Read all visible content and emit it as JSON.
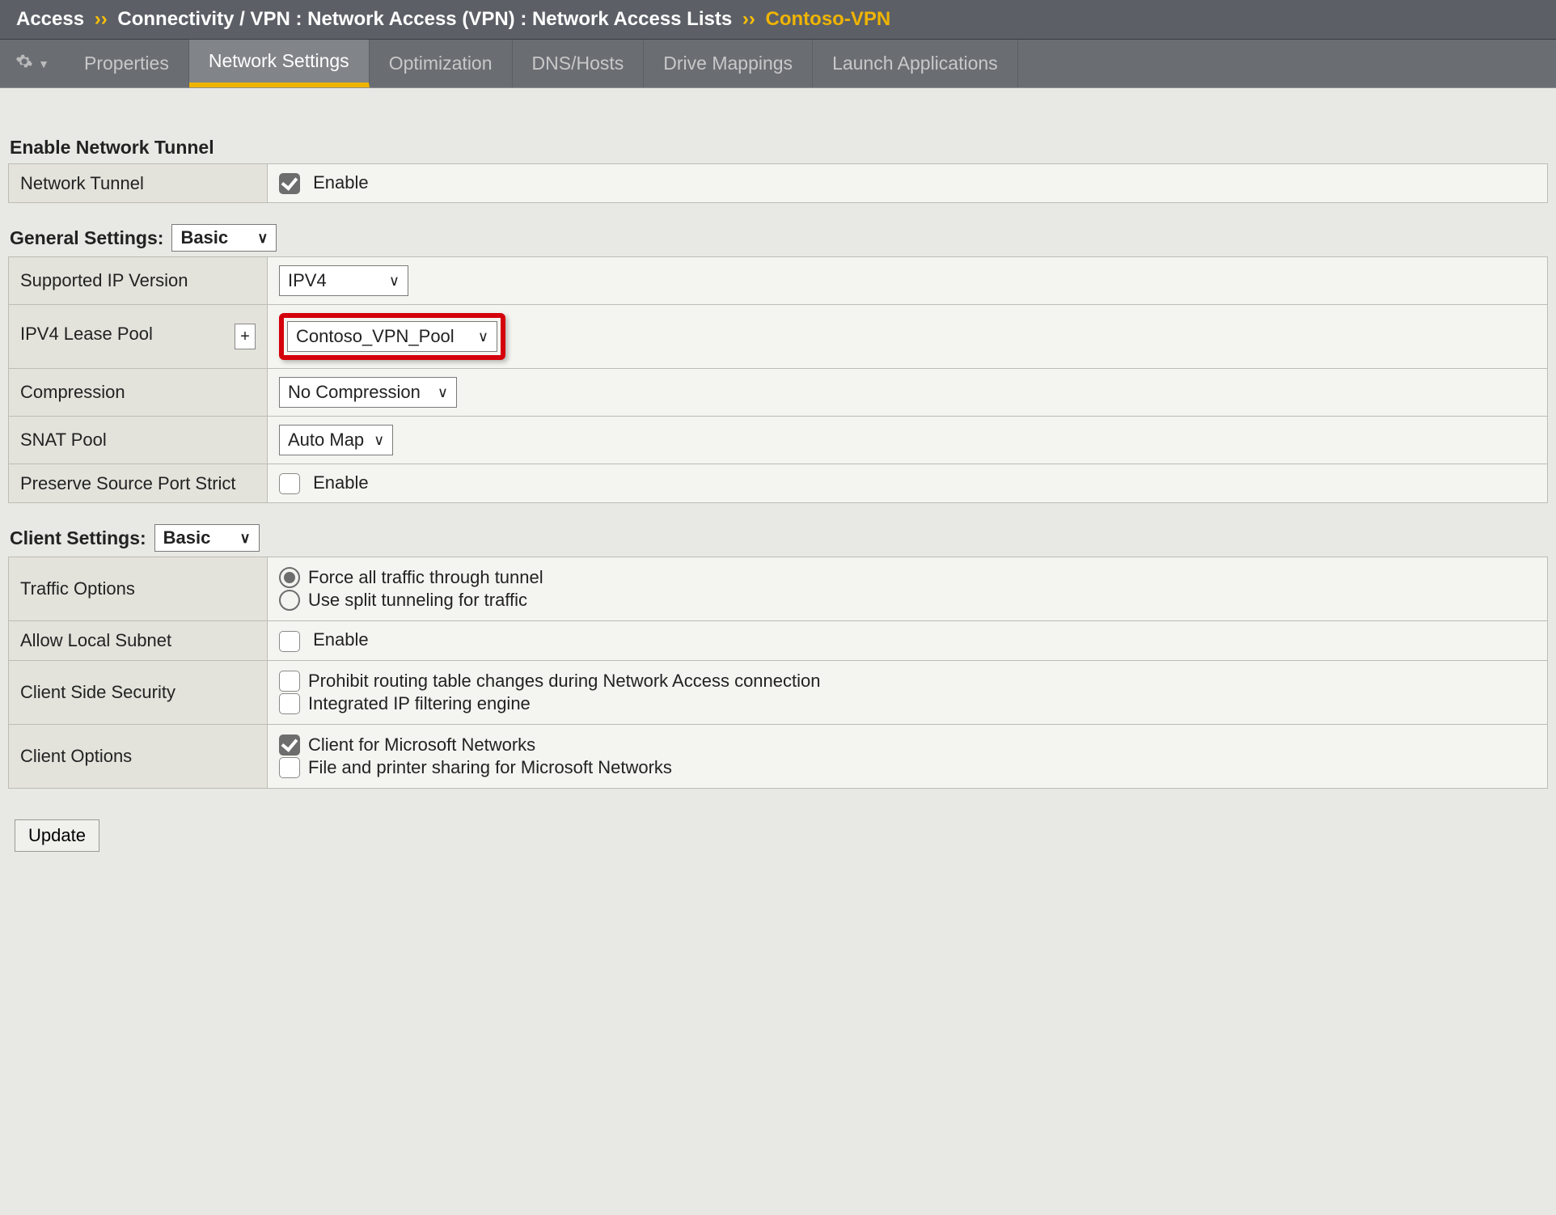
{
  "breadcrumb": {
    "root": "Access",
    "path": "Connectivity / VPN : Network Access (VPN) : Network Access Lists",
    "current": "Contoso-VPN",
    "sep": "››"
  },
  "tabs": [
    "Properties",
    "Network Settings",
    "Optimization",
    "DNS/Hosts",
    "Drive Mappings",
    "Launch Applications"
  ],
  "activeTab": "Network Settings",
  "enableTunnel": {
    "title": "Enable Network Tunnel",
    "row_label": "Network Tunnel",
    "enable_label": "Enable",
    "checked": true
  },
  "general": {
    "title": "General Settings:",
    "mode": "Basic",
    "rows": {
      "ip_version": {
        "label": "Supported IP Version",
        "value": "IPV4"
      },
      "lease_pool": {
        "label": "IPV4 Lease Pool",
        "value": "Contoso_VPN_Pool",
        "add": "+"
      },
      "compression": {
        "label": "Compression",
        "value": "No Compression"
      },
      "snat": {
        "label": "SNAT Pool",
        "value": "Auto Map"
      },
      "preserve": {
        "label": "Preserve Source Port Strict",
        "enable_label": "Enable",
        "checked": false
      }
    }
  },
  "client": {
    "title": "Client Settings:",
    "mode": "Basic",
    "traffic": {
      "label": "Traffic Options",
      "opt1": "Force all traffic through tunnel",
      "opt2": "Use split tunneling for traffic",
      "selected": 0
    },
    "allow_local": {
      "label": "Allow Local Subnet",
      "enable_label": "Enable",
      "checked": false
    },
    "security": {
      "label": "Client Side Security",
      "opt1": "Prohibit routing table changes during Network Access connection",
      "opt1_checked": false,
      "opt2": "Integrated IP filtering engine",
      "opt2_checked": false
    },
    "options": {
      "label": "Client Options",
      "opt1": "Client for Microsoft Networks",
      "opt1_checked": true,
      "opt2": "File and printer sharing for Microsoft Networks",
      "opt2_checked": false
    }
  },
  "update_button": "Update"
}
